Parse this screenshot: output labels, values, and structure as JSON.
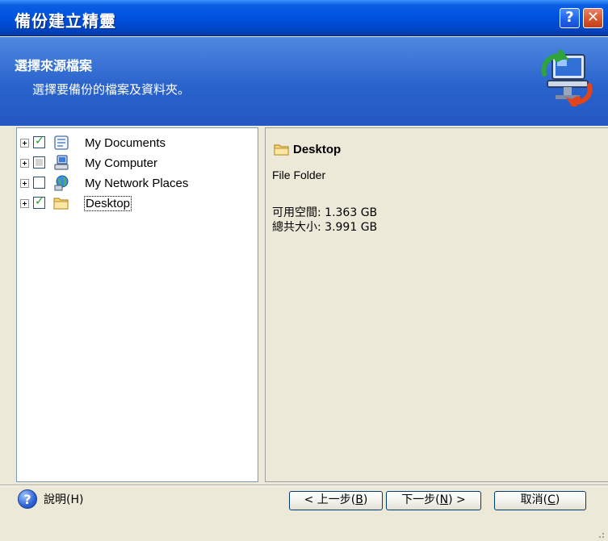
{
  "window": {
    "title": "備份建立精靈",
    "help_button": "?",
    "close_button": "✕"
  },
  "header": {
    "title": "選擇來源檔案",
    "subtitle": "選擇要備份的檔案及資料夾。"
  },
  "tree": {
    "items": [
      {
        "label": "My Documents",
        "checked": "checked",
        "icon": "documents-icon"
      },
      {
        "label": "My Computer",
        "checked": "partial",
        "icon": "computer-icon"
      },
      {
        "label": "My Network Places",
        "checked": "unchecked",
        "icon": "network-places-icon"
      },
      {
        "label": "Desktop",
        "checked": "checked",
        "icon": "folder-icon",
        "selected": true
      }
    ]
  },
  "details": {
    "name": "Desktop",
    "type": "File Folder",
    "free_space": "可用空間: 1.363 GB",
    "total_size": "總共大小: 3.991 GB"
  },
  "footer": {
    "help_label": "說明(H)",
    "back_prefix": "< 上一步(",
    "back_key": "B",
    "back_suffix": ")",
    "next_prefix": "下一步(",
    "next_key": "N",
    "next_suffix": ") >",
    "cancel_prefix": "取消(",
    "cancel_key": "C",
    "cancel_suffix": ")"
  },
  "colors": {
    "title_bar": "#0054e3",
    "header_bg": "#2a63cc",
    "check": "#21a121"
  }
}
